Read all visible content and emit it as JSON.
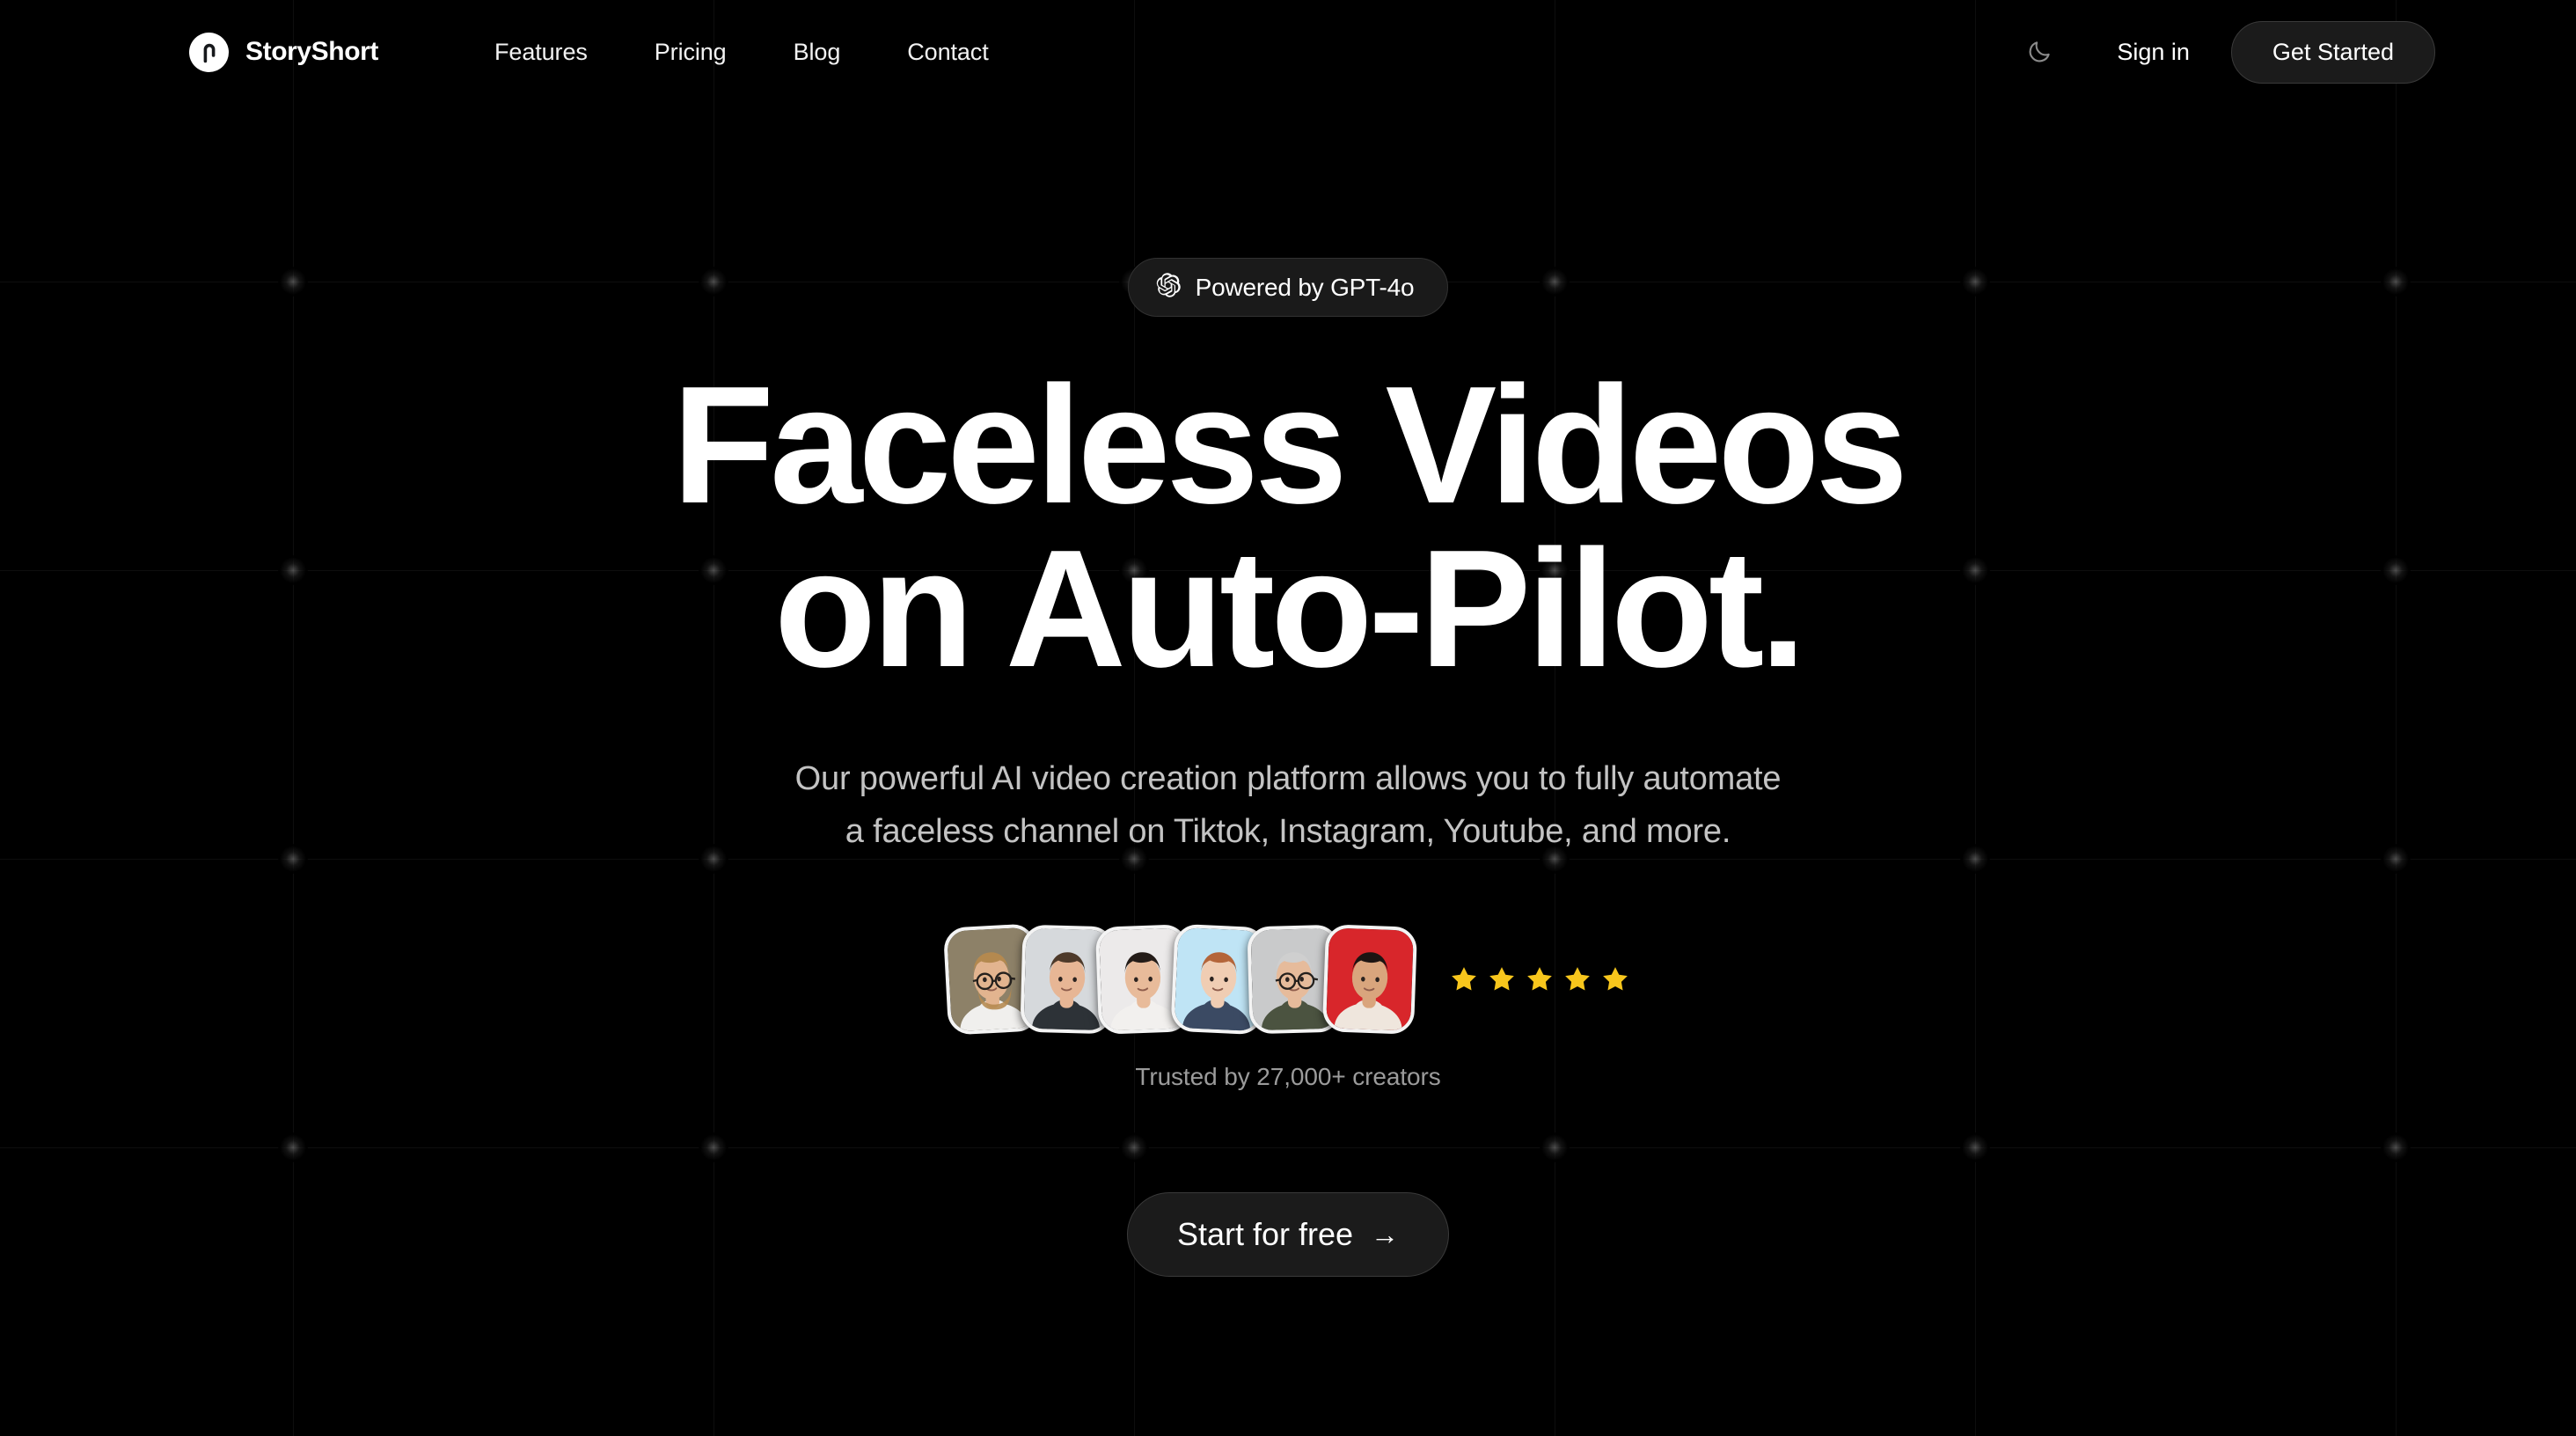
{
  "theme": {
    "background": "#000000",
    "text_primary": "#ffffff",
    "text_muted": "#c3c3c3",
    "surface": "#1b1b1b",
    "border": "#3a3a3a",
    "star_color": "#f8c61c",
    "grid_line": "rgba(255,255,255,0.055)"
  },
  "nav": {
    "brand": "StoryShort",
    "brand_icon": "storyshort-logo-icon",
    "links": [
      {
        "label": "Features"
      },
      {
        "label": "Pricing"
      },
      {
        "label": "Blog"
      },
      {
        "label": "Contact"
      }
    ],
    "theme_toggle_icon": "moon-icon",
    "signin_label": "Sign in",
    "cta_label": "Get Started"
  },
  "hero": {
    "badge": {
      "icon": "openai-logo-icon",
      "label": "Powered by GPT-4o"
    },
    "headline_line1": "Faceless Videos",
    "headline_line2": "on Auto-Pilot.",
    "subhead_line1": "Our powerful AI video creation platform allows you to fully automate",
    "subhead_line2": "a faceless channel on Tiktok, Instagram, Youtube, and more.",
    "social_proof": {
      "avatars": [
        {
          "name": "avatar-1",
          "bg": "#8d8168",
          "skin": "#e2b48f",
          "hair": "#b4894f",
          "shirt": "#f0efed",
          "glasses": true,
          "beard": true
        },
        {
          "name": "avatar-2",
          "bg": "#d6d9dc",
          "skin": "#e7b695",
          "hair": "#4e3a2a",
          "shirt": "#2d3237",
          "glasses": false,
          "beard": false
        },
        {
          "name": "avatar-3",
          "bg": "#eceaea",
          "skin": "#e8bb9a",
          "hair": "#241c18",
          "shirt": "#f2f0ee",
          "glasses": false,
          "beard": false
        },
        {
          "name": "avatar-4",
          "bg": "#bfe4f5",
          "skin": "#f0cdb3",
          "hair": "#b4653a",
          "shirt": "#3b4a63",
          "glasses": false,
          "beard": false
        },
        {
          "name": "avatar-5",
          "bg": "#c9cacb",
          "skin": "#e6bb9b",
          "hair": "#cfcfcf",
          "shirt": "#4b5340",
          "glasses": true,
          "beard": false
        },
        {
          "name": "avatar-6",
          "bg": "#d8262b",
          "skin": "#d9a57d",
          "hair": "#1c1412",
          "shirt": "#efe6dd",
          "glasses": false,
          "beard": false
        }
      ],
      "star_count": 5,
      "trusted_label": "Trusted by 27,000+ creators"
    },
    "cta_label": "Start for free",
    "cta_arrow": "→"
  }
}
